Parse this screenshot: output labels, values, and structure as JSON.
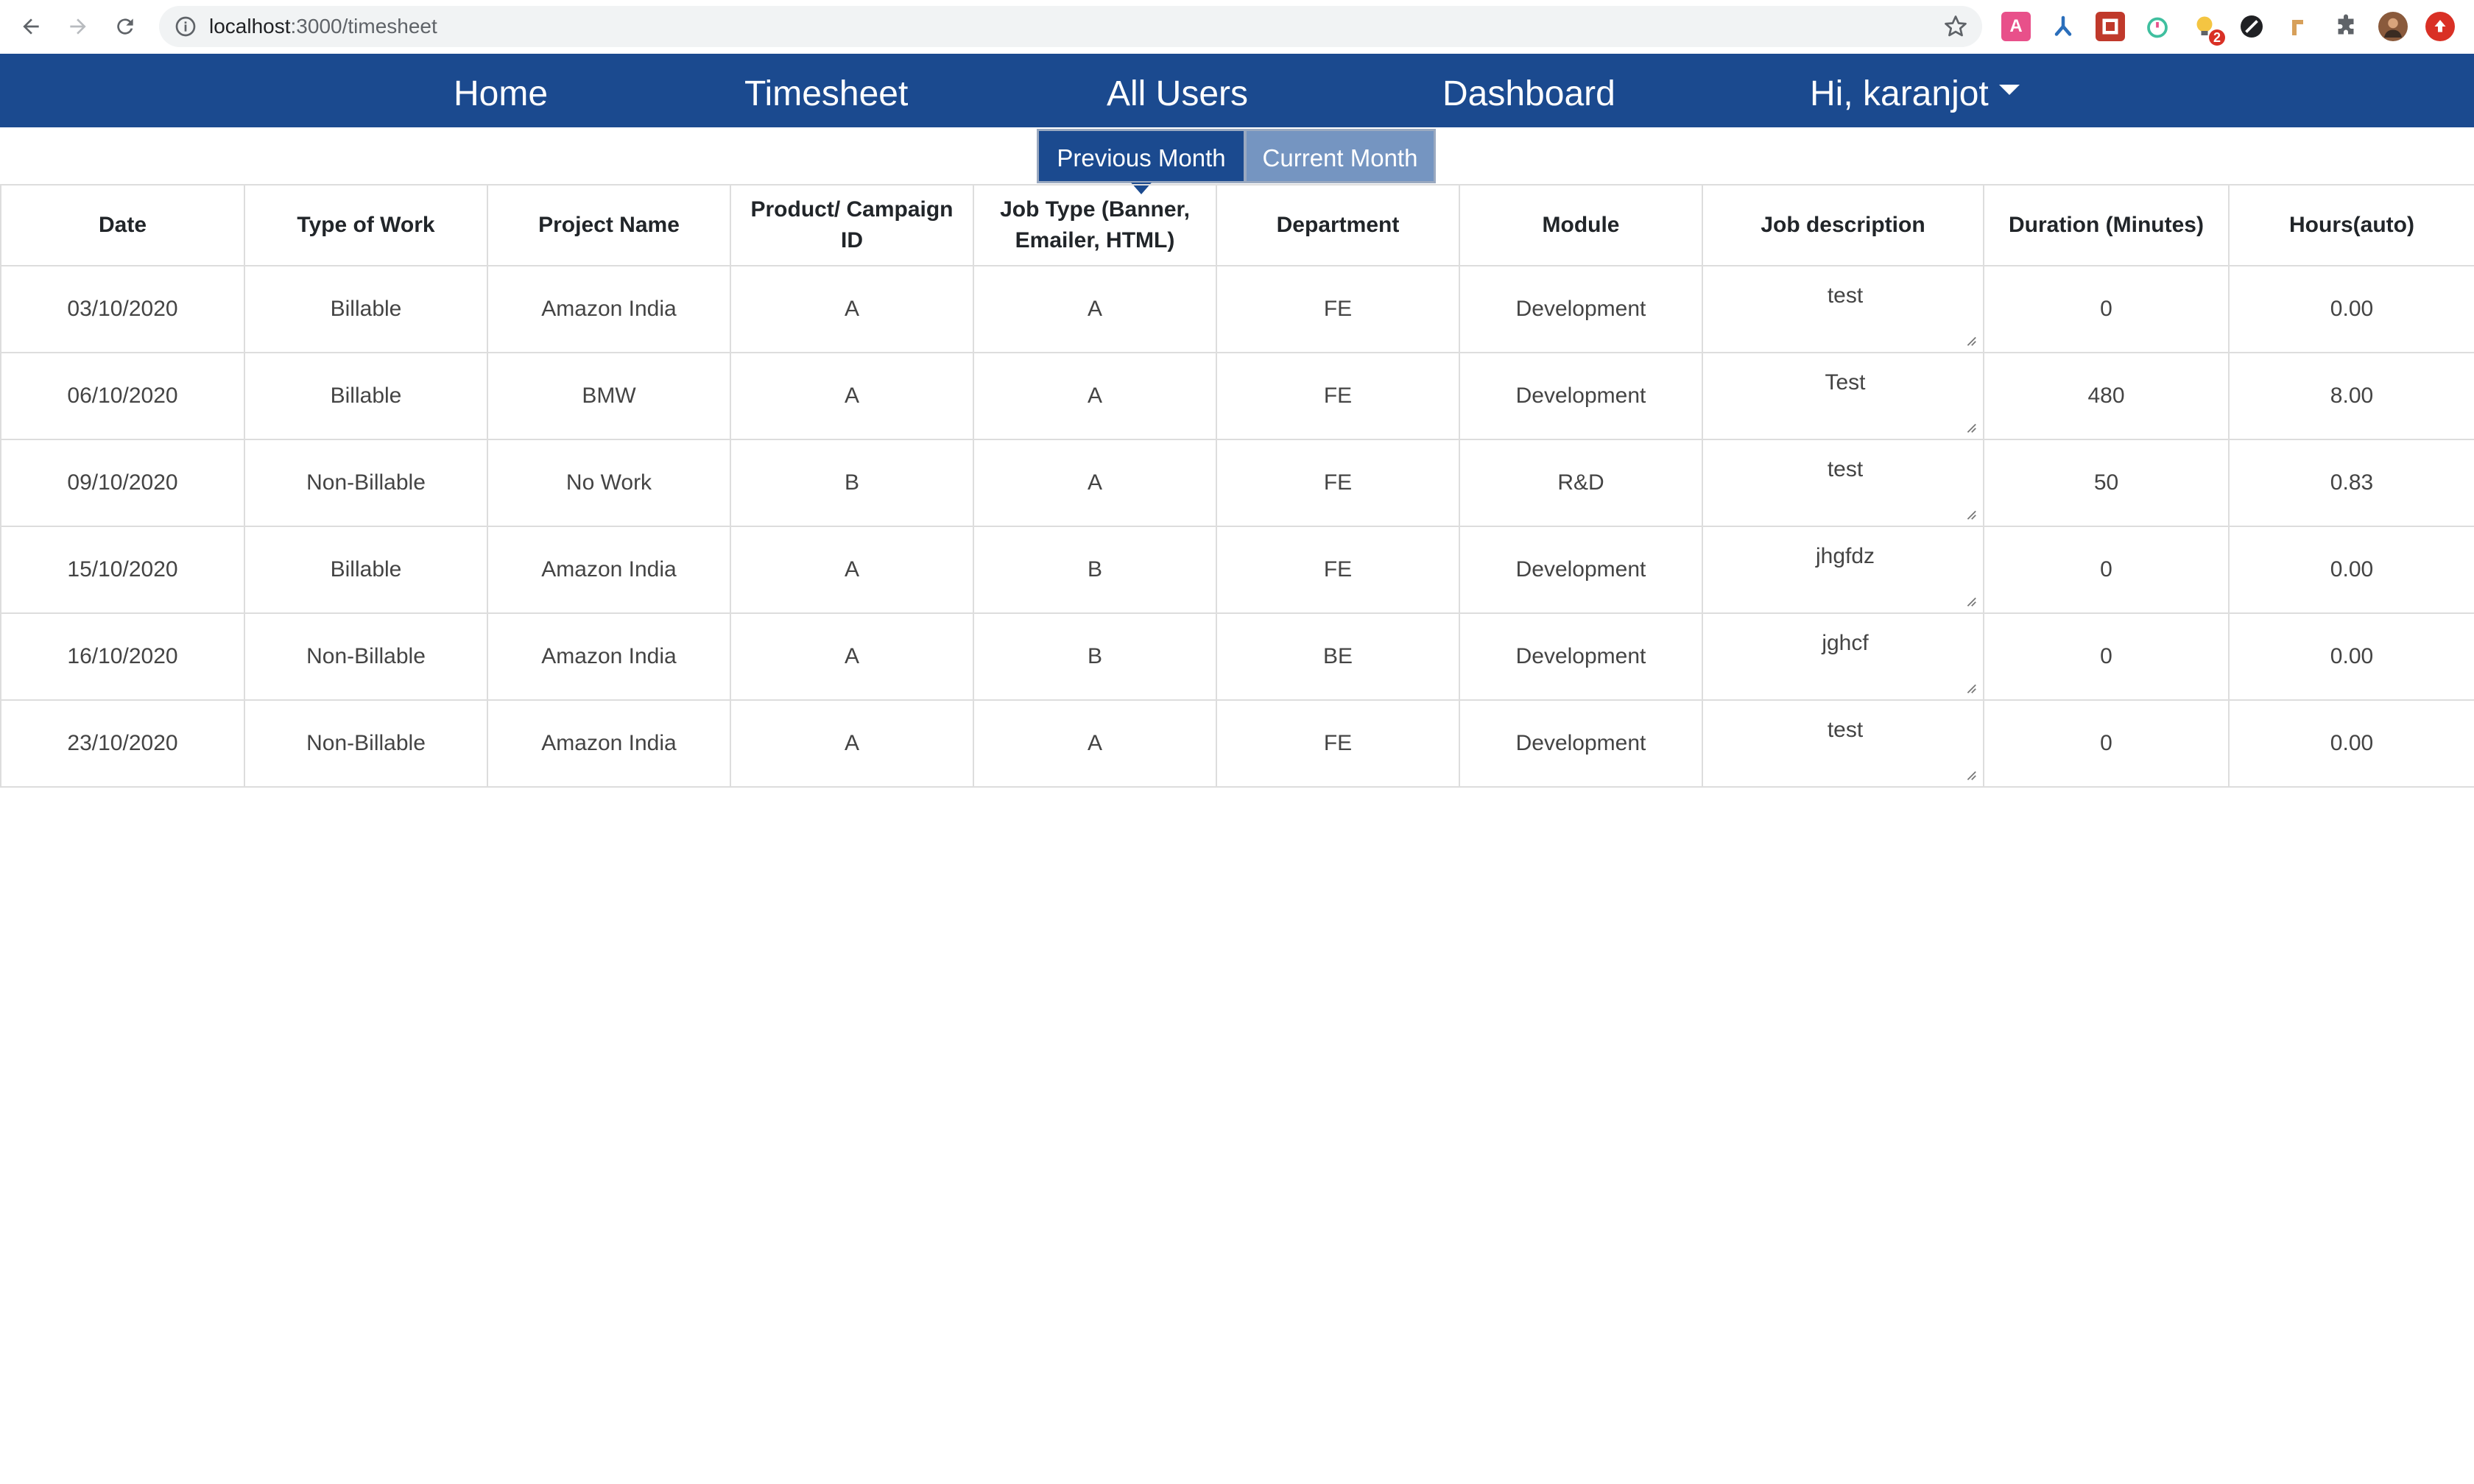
{
  "browser": {
    "url_host": "localhost",
    "url_path": ":3000/timesheet",
    "extensions": [
      {
        "name": "acrobat-icon",
        "color": "#e8508a",
        "glyph": "A"
      },
      {
        "name": "fork-icon",
        "color": "#ffffff",
        "glyph": ""
      },
      {
        "name": "puzzle-red-icon",
        "color": "#c0392b",
        "glyph": ""
      },
      {
        "name": "timer-icon",
        "color": "#ffffff",
        "glyph": ""
      },
      {
        "name": "bulb-icon",
        "color": "#ffffff",
        "glyph": "",
        "badge": "2"
      },
      {
        "name": "circle-slash-icon",
        "color": "#202124",
        "glyph": ""
      },
      {
        "name": "pin-icon",
        "color": "#ffffff",
        "glyph": ""
      },
      {
        "name": "extensions-icon",
        "color": "#ffffff",
        "glyph": ""
      },
      {
        "name": "profile-avatar",
        "color": "#8a5a3c",
        "glyph": ""
      },
      {
        "name": "update-icon",
        "color": "#d93025",
        "glyph": ""
      }
    ]
  },
  "nav": {
    "home": "Home",
    "timesheet": "Timesheet",
    "all_users": "All Users",
    "dashboard": "Dashboard",
    "user_menu": "Hi, karanjot"
  },
  "month_toggle": {
    "previous": "Previous Month",
    "current": "Current Month",
    "selected": "Previous Month"
  },
  "table": {
    "headers": [
      "Date",
      "Type of Work",
      "Project Name",
      "Product/ Campaign ID",
      "Job Type (Banner, Emailer, HTML)",
      "Department",
      "Module",
      "Job description",
      "Duration (Minutes)",
      "Hours(auto)"
    ],
    "rows": [
      [
        "03/10/2020",
        "Billable",
        "Amazon India",
        "A",
        "A",
        "FE",
        "Development",
        "test",
        "0",
        "0.00"
      ],
      [
        "06/10/2020",
        "Billable",
        "BMW",
        "A",
        "A",
        "FE",
        "Development",
        "Test",
        "480",
        "8.00"
      ],
      [
        "09/10/2020",
        "Non-Billable",
        "No Work",
        "B",
        "A",
        "FE",
        "R&D",
        "test",
        "50",
        "0.83"
      ],
      [
        "15/10/2020",
        "Billable",
        "Amazon India",
        "A",
        "B",
        "FE",
        "Development",
        "jhgfdz",
        "0",
        "0.00"
      ],
      [
        "16/10/2020",
        "Non-Billable",
        "Amazon India",
        "A",
        "B",
        "BE",
        "Development",
        "jghcf",
        "0",
        "0.00"
      ],
      [
        "23/10/2020",
        "Non-Billable",
        "Amazon India",
        "A",
        "A",
        "FE",
        "Development",
        "test",
        "0",
        "0.00"
      ]
    ]
  },
  "colors": {
    "nav_bg": "#1b4a8f",
    "toggle_active": "#1b4a8f",
    "toggle_inactive": "#7595c1",
    "table_border": "#dddddd"
  }
}
